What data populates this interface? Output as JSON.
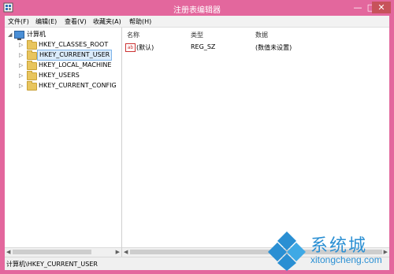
{
  "window": {
    "title": "注册表编辑器",
    "minimize_glyph": "—",
    "maximize_glyph": "□",
    "close_glyph": "✕"
  },
  "menu": {
    "items": [
      "文件(F)",
      "编辑(E)",
      "查看(V)",
      "收藏夹(A)",
      "帮助(H)"
    ]
  },
  "tree": {
    "root": "计算机",
    "items": [
      {
        "label": "HKEY_CLASSES_ROOT",
        "selected": false
      },
      {
        "label": "HKEY_CURRENT_USER",
        "selected": true
      },
      {
        "label": "HKEY_LOCAL_MACHINE",
        "selected": false
      },
      {
        "label": "HKEY_USERS",
        "selected": false
      },
      {
        "label": "HKEY_CURRENT_CONFIG",
        "selected": false
      }
    ]
  },
  "list": {
    "columns": [
      "名称",
      "类型",
      "数据"
    ],
    "rows": [
      {
        "name": "(默认)",
        "type": "REG_SZ",
        "data": "(数值未设置)",
        "icon": "ab"
      }
    ]
  },
  "status": {
    "path": "计算机\\HKEY_CURRENT_USER"
  },
  "watermark": {
    "text_cn": "系统城",
    "text_en": "xitongcheng.com"
  },
  "colors": {
    "window_frame": "#e3679d",
    "selection_bg": "#dbecfb",
    "watermark": "#2a8fd3"
  }
}
